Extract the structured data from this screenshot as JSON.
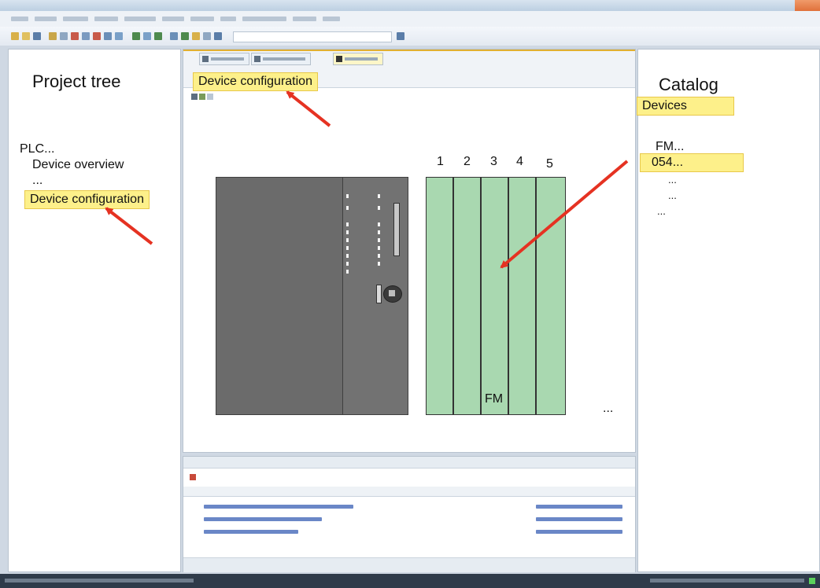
{
  "left": {
    "title": "Project tree",
    "items": [
      "PLC...",
      "Device overview",
      "..."
    ],
    "highlight": "Device configuration"
  },
  "center": {
    "highlight": "Device configuration",
    "slots": [
      "1",
      "2",
      "3",
      "4",
      "5"
    ],
    "slot_label": "FM",
    "more": "..."
  },
  "right": {
    "title": "Catalog",
    "highlight": "Devices",
    "folder": "FM...",
    "item_highlight": "054...",
    "sub_items": [
      "...",
      "...",
      "..."
    ]
  },
  "colors": {
    "highlight": "#fdf08a",
    "arrow": "#e53222",
    "slot": "#a9d8b0",
    "module": "#6b6b6b"
  }
}
